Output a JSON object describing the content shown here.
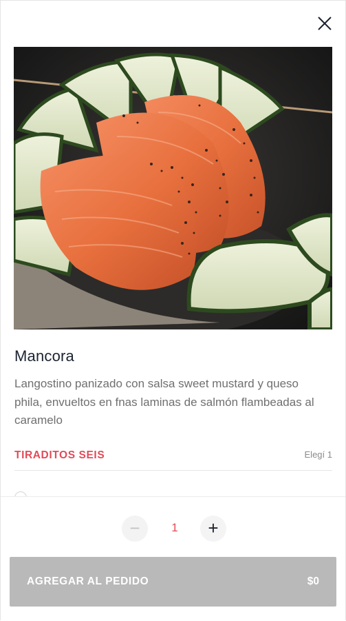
{
  "product": {
    "name": "Mancora",
    "description": "Langostino panizado con salsa sweet mustard y queso phila, envueltos en fnas laminas de salmón flambeadas al caramelo",
    "image_icon": "salmon-tiradito-photo"
  },
  "option_group": {
    "title": "TIRADITOS SEIS",
    "hint": "Elegí 1"
  },
  "quantity": {
    "value": "1",
    "minus_symbol": "−",
    "plus_symbol": "+"
  },
  "cta": {
    "label": "AGREGAR AL PEDIDO",
    "price": "$0"
  },
  "colors": {
    "accent": "#e24a58",
    "button_disabled": "#b9b9b9",
    "title_text": "#1c2330",
    "body_text": "#6f6f6f"
  }
}
